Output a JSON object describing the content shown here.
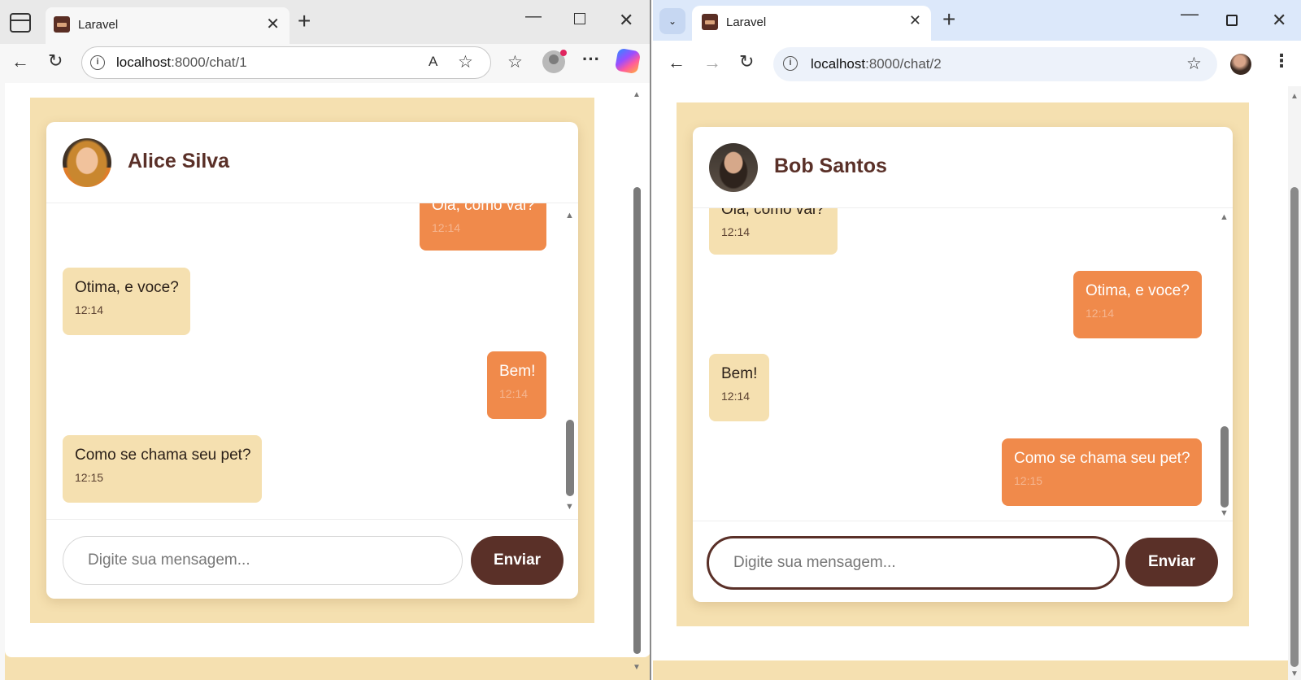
{
  "left_window": {
    "browser": "edge",
    "tab": {
      "title": "Laravel",
      "close": "✕"
    },
    "new_tab": "+",
    "window_controls": {
      "minimize": "—",
      "close": "✕"
    },
    "nav": {
      "back": "←",
      "reload": "↻"
    },
    "address": {
      "host": "localhost",
      "path": ":8000/chat/1",
      "info": "i"
    },
    "toolbar_icons": {
      "read_aloud": "A",
      "favorite": "☆",
      "favorites": "☆",
      "more": "···"
    },
    "scroll_arrows": {
      "up": "▲",
      "down": "▼"
    },
    "chat": {
      "contact_name": "Alice Silva",
      "avatar": "alice-avatar",
      "messages": [
        {
          "text": "Olá, como vai?",
          "time": "12:14",
          "side": "sent"
        },
        {
          "text": "Otima, e voce?",
          "time": "12:14",
          "side": "received"
        },
        {
          "text": "Bem!",
          "time": "12:14",
          "side": "sent"
        },
        {
          "text": "Como se chama seu pet?",
          "time": "12:15",
          "side": "received"
        }
      ],
      "input_placeholder": "Digite sua mensagem...",
      "send_label": "Enviar"
    }
  },
  "right_window": {
    "browser": "chrome",
    "tab_search": "⌄",
    "tab": {
      "title": "Laravel",
      "close": "✕"
    },
    "new_tab": "+",
    "window_controls": {
      "minimize": "—",
      "close": "✕"
    },
    "nav": {
      "back": "←",
      "forward": "→",
      "reload": "↻"
    },
    "address": {
      "host": "localhost",
      "path": ":8000/chat/2",
      "info": "i"
    },
    "toolbar_icons": {
      "bookmark": "☆",
      "more": "⋮"
    },
    "scroll_arrows": {
      "up": "▲",
      "down": "▼"
    },
    "chat": {
      "contact_name": "Bob Santos",
      "avatar": "bob-avatar",
      "messages": [
        {
          "text": "Olá, como vai?",
          "time": "12:14",
          "side": "received"
        },
        {
          "text": "Otima, e voce?",
          "time": "12:14",
          "side": "sent"
        },
        {
          "text": "Bem!",
          "time": "12:14",
          "side": "received"
        },
        {
          "text": "Como se chama seu pet?",
          "time": "12:15",
          "side": "sent"
        }
      ],
      "input_placeholder": "Digite sua mensagem...",
      "send_label": "Enviar"
    }
  },
  "colors": {
    "page_background": "#f5e0b0",
    "received_bubble": "#f5e0b0",
    "sent_bubble": "#f08a4b",
    "accent_brown": "#5a3028"
  }
}
